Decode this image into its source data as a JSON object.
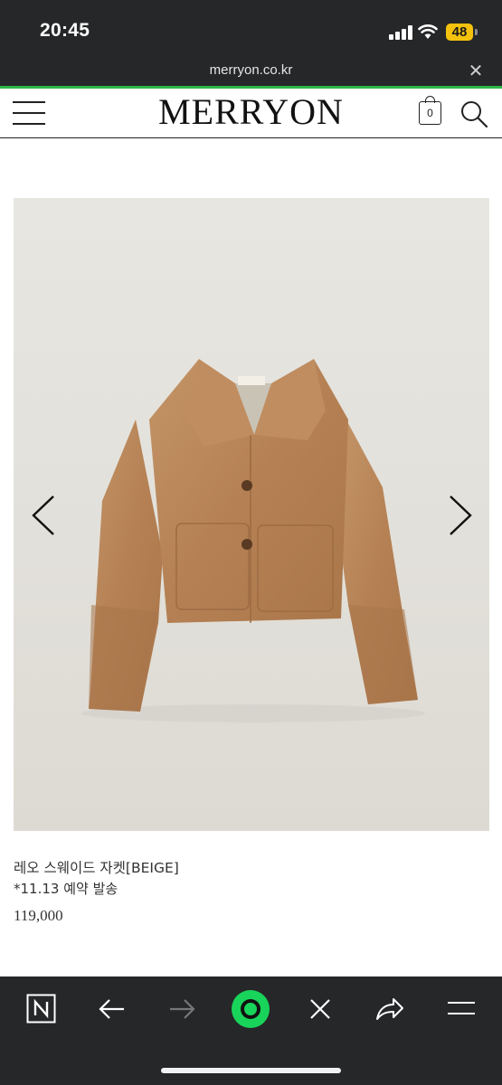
{
  "status_bar": {
    "time": "20:45",
    "battery": "48"
  },
  "browser": {
    "url": "merryon.co.kr"
  },
  "site": {
    "logo": "MERRYON",
    "cart_count": "0"
  },
  "product": {
    "name": "레오 스웨이드 자켓[BEIGE]",
    "note": "*11.13 예약 발송",
    "price": "119,000"
  },
  "colors": {
    "accent_progress": "#2db847",
    "chrome_dark": "#262728",
    "jacket": "#b98659"
  },
  "icons": [
    "menu-icon",
    "cart-icon",
    "search-icon",
    "chevron-left-icon",
    "chevron-right-icon",
    "naver-icon",
    "back-icon",
    "forward-icon",
    "green-dot-icon",
    "close-icon",
    "share-icon",
    "hamburger-icon"
  ]
}
